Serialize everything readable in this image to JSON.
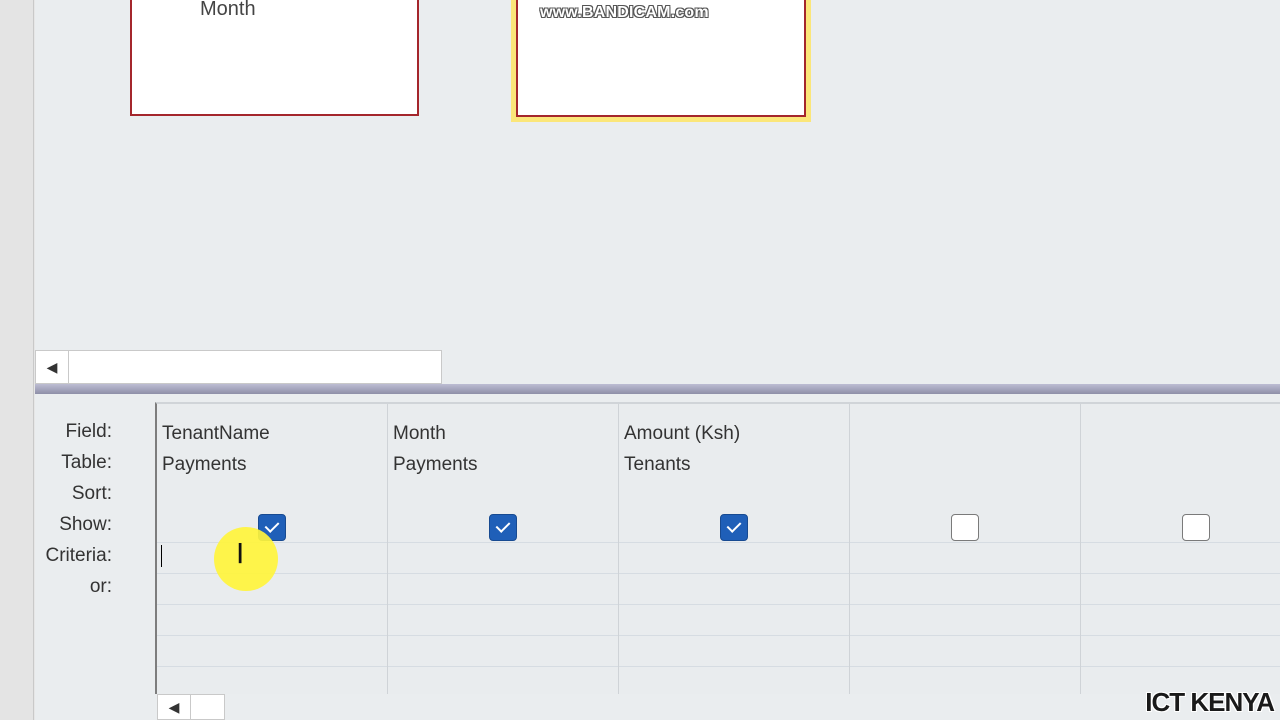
{
  "design_pane": {
    "tables": [
      {
        "visible_field": "Month"
      },
      {
        "visible_field": ""
      }
    ]
  },
  "watermark": "www.BANDICAM.com",
  "grid": {
    "row_labels": {
      "field": "Field:",
      "table": "Table:",
      "sort": "Sort:",
      "show": "Show:",
      "criteria": "Criteria:",
      "or": "or:"
    },
    "columns": [
      {
        "field": "TenantName",
        "table": "Payments",
        "show": true
      },
      {
        "field": "Month",
        "table": "Payments",
        "show": true
      },
      {
        "field": "Amount (Ksh)",
        "table": "Tenants",
        "show": true
      },
      {
        "field": "",
        "table": "",
        "show": false
      },
      {
        "field": "",
        "table": "",
        "show": false
      }
    ]
  },
  "icons": {
    "scroll_left": "◀",
    "text_cursor": "I"
  },
  "brand": "ICT KENYA"
}
